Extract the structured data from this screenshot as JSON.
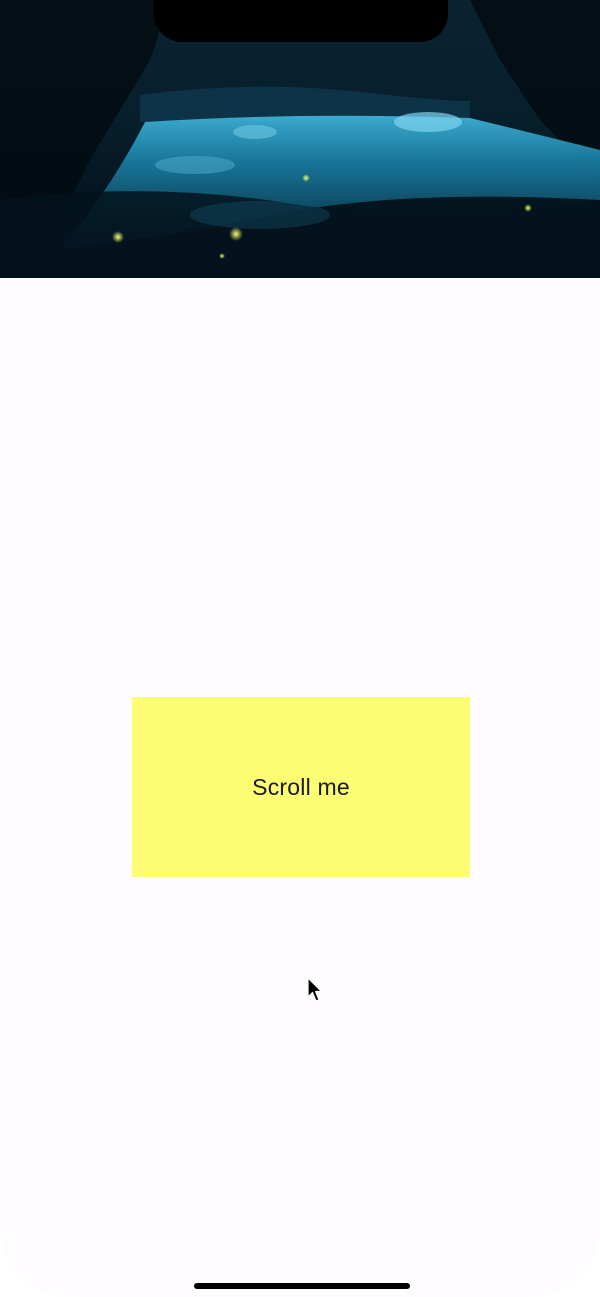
{
  "header": {
    "image_description_icon": "forest-river-night-image"
  },
  "scroll_box": {
    "label": "Scroll me",
    "color": "#fdfd74"
  },
  "cursor": {
    "icon": "mouse-pointer-icon"
  },
  "colors": {
    "background": "#fefcff",
    "notch": "#000000",
    "home_indicator": "#000000"
  }
}
